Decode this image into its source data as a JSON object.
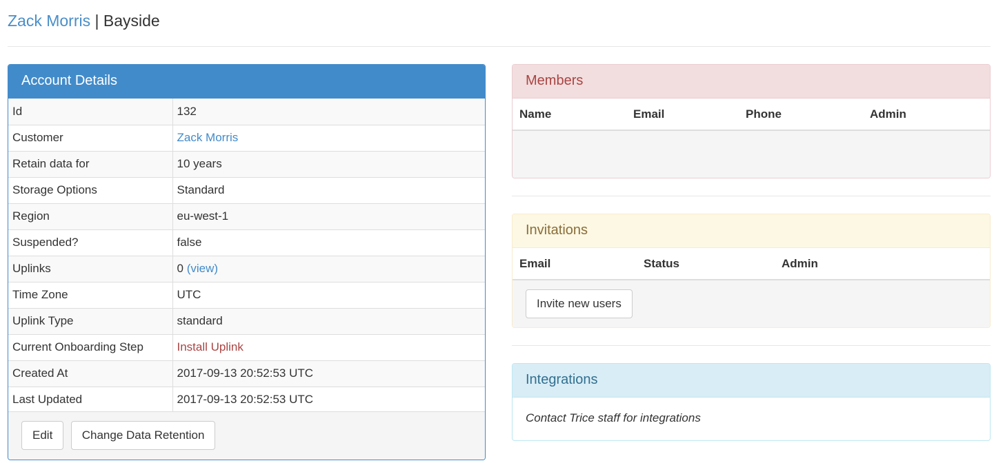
{
  "header": {
    "customer_link": "Zack Morris",
    "separator": "|",
    "account_name": "Bayside"
  },
  "account_details": {
    "title": "Account Details",
    "rows": [
      {
        "key": "Id",
        "value": "132"
      },
      {
        "key": "Customer",
        "value": "Zack Morris"
      },
      {
        "key": "Retain data for",
        "value": "10 years"
      },
      {
        "key": "Storage Options",
        "value": "Standard"
      },
      {
        "key": "Region",
        "value": "eu-west-1"
      },
      {
        "key": "Suspended?",
        "value": "false"
      },
      {
        "key": "Uplinks",
        "value": "0",
        "link": "(view)"
      },
      {
        "key": "Time Zone",
        "value": "UTC"
      },
      {
        "key": "Uplink Type",
        "value": "standard"
      },
      {
        "key": "Current Onboarding Step",
        "value": "Install Uplink"
      },
      {
        "key": "Created At",
        "value": "2017-09-13 20:52:53 UTC"
      },
      {
        "key": "Last Updated",
        "value": "2017-09-13 20:52:53 UTC"
      }
    ],
    "buttons": {
      "edit": "Edit",
      "change_retention": "Change Data Retention"
    }
  },
  "members": {
    "title": "Members",
    "columns": [
      "Name",
      "Email",
      "Phone",
      "Admin"
    ]
  },
  "invitations": {
    "title": "Invitations",
    "columns": [
      "Email",
      "Status",
      "Admin"
    ],
    "invite_button": "Invite new users"
  },
  "integrations": {
    "title": "Integrations",
    "message": "Contact Trice staff for integrations"
  },
  "colors": {
    "primary": "#428bca",
    "danger_bg": "#f2dede",
    "warning_bg": "#fcf8e3",
    "info_bg": "#d9edf7"
  }
}
